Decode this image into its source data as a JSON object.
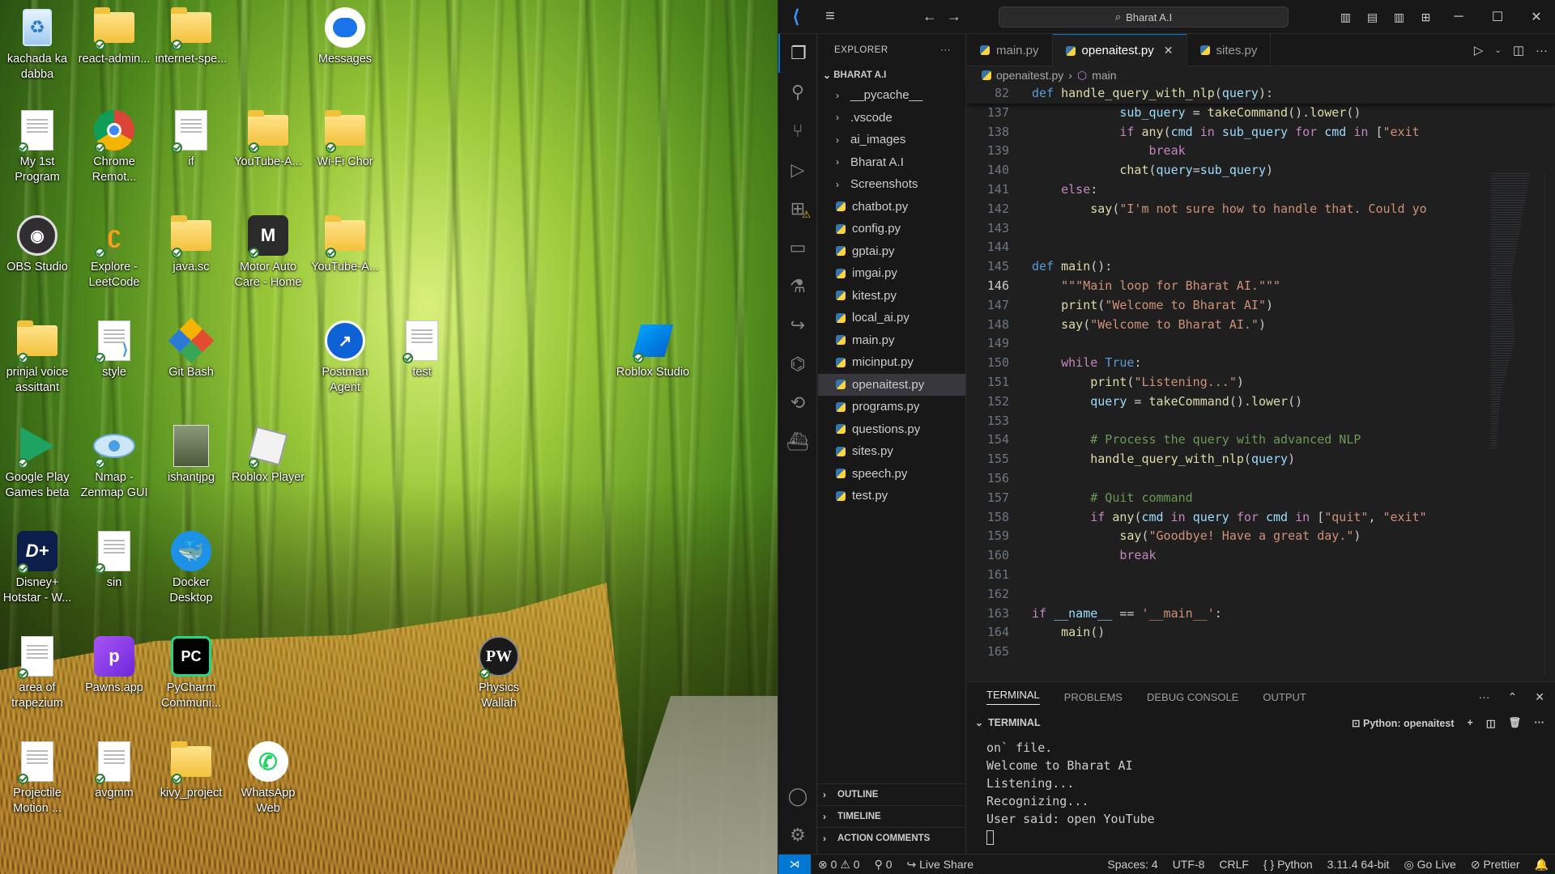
{
  "desktop": {
    "icons": [
      {
        "label": "kachada ka dabba",
        "icon": "recycle-bin-icon"
      },
      {
        "label": "react-admin...",
        "icon": "folder-icon"
      },
      {
        "label": "internet-spe...",
        "icon": "folder-icon"
      },
      {
        "label": "Messages",
        "icon": "messages-icon"
      },
      {
        "label": "My 1st Program",
        "icon": "document-icon"
      },
      {
        "label": "Chrome Remot...",
        "icon": "chrome-remote-icon"
      },
      {
        "label": "if",
        "icon": "document-icon"
      },
      {
        "label": "YouTube-A...",
        "icon": "folder-icon"
      },
      {
        "label": "Wi-Fi Chor",
        "icon": "folder-icon"
      },
      {
        "label": "OBS Studio",
        "icon": "obs-icon"
      },
      {
        "label": "Explore - LeetCode",
        "icon": "leetcode-icon"
      },
      {
        "label": "java.sc",
        "icon": "folder-icon"
      },
      {
        "label": "Motor Auto Care - Home",
        "icon": "motor-auto-icon"
      },
      {
        "label": "YouTube-A...",
        "icon": "folder-icon"
      },
      {
        "label": "prinjal voice assittant",
        "icon": "folder-icon"
      },
      {
        "label": "style",
        "icon": "vscode-file-icon"
      },
      {
        "label": "Git Bash",
        "icon": "git-bash-icon"
      },
      {
        "label": "Postman Agent",
        "icon": "postman-icon"
      },
      {
        "label": "test",
        "icon": "document-icon"
      },
      {
        "label": "Roblox Studio",
        "icon": "roblox-studio-icon"
      },
      {
        "label": "Google Play Games beta",
        "icon": "google-play-games-icon"
      },
      {
        "label": "Nmap - Zenmap GUI",
        "icon": "nmap-icon"
      },
      {
        "label": "ishantjpg",
        "icon": "photo-icon"
      },
      {
        "label": "Roblox Player",
        "icon": "roblox-player-icon"
      },
      {
        "label": "Disney+ Hotstar - W...",
        "icon": "hotstar-icon"
      },
      {
        "label": "sin",
        "icon": "document-icon"
      },
      {
        "label": "Docker Desktop",
        "icon": "docker-icon"
      },
      {
        "label": "area of trapezium",
        "icon": "document-icon"
      },
      {
        "label": "Pawns.app",
        "icon": "pawns-icon"
      },
      {
        "label": "PyCharm Communi...",
        "icon": "pycharm-icon"
      },
      {
        "label": "Physics Wallah",
        "icon": "physics-wallah-icon"
      },
      {
        "label": "Projectile Motion ...",
        "icon": "document-icon"
      },
      {
        "label": "avgmm",
        "icon": "document-icon"
      },
      {
        "label": "kivy_project",
        "icon": "folder-icon"
      },
      {
        "label": "WhatsApp Web",
        "icon": "whatsapp-icon"
      }
    ]
  },
  "vscode": {
    "search": "Bharat A.I",
    "explorer": {
      "title": "EXPLORER",
      "root": "BHARAT A.I",
      "folders": [
        "__pycache__",
        ".vscode",
        "ai_images",
        "Bharat A.I",
        "Screenshots"
      ],
      "files": [
        "chatbot.py",
        "config.py",
        "gptai.py",
        "imgai.py",
        "kitest.py",
        "local_ai.py",
        "main.py",
        "micinput.py",
        "openaitest.py",
        "programs.py",
        "questions.py",
        "sites.py",
        "speech.py",
        "test.py"
      ],
      "selected": "openaitest.py",
      "sections": [
        "OUTLINE",
        "TIMELINE",
        "ACTION COMMENTS"
      ]
    },
    "tabs": [
      {
        "label": "main.py",
        "active": false
      },
      {
        "label": "openaitest.py",
        "active": true
      },
      {
        "label": "sites.py",
        "active": false
      }
    ],
    "breadcrumb": {
      "file": "openaitest.py",
      "symbol": "main"
    },
    "code": {
      "sticky": {
        "ln": "82",
        "text": "def handle_query_with_nlp(query):"
      },
      "lines": [
        {
          "ln": "137",
          "text": "            sub_query = takeCommand().lower()"
        },
        {
          "ln": "138",
          "text": "            if any(cmd in sub_query for cmd in [\"exit"
        },
        {
          "ln": "139",
          "text": "                break"
        },
        {
          "ln": "140",
          "text": "            chat(query=sub_query)"
        },
        {
          "ln": "141",
          "text": "    else:"
        },
        {
          "ln": "142",
          "text": "        say(\"I'm not sure how to handle that. Could yo"
        },
        {
          "ln": "143",
          "text": ""
        },
        {
          "ln": "144",
          "text": ""
        },
        {
          "ln": "145",
          "text": "def main():"
        },
        {
          "ln": "146",
          "text": "    \"\"\"Main loop for Bharat AI.\"\"\""
        },
        {
          "ln": "147",
          "text": "    print(\"Welcome to Bharat AI\")"
        },
        {
          "ln": "148",
          "text": "    say(\"Welcome to Bharat AI.\")"
        },
        {
          "ln": "149",
          "text": ""
        },
        {
          "ln": "150",
          "text": "    while True:"
        },
        {
          "ln": "151",
          "text": "        print(\"Listening...\")"
        },
        {
          "ln": "152",
          "text": "        query = takeCommand().lower()"
        },
        {
          "ln": "153",
          "text": ""
        },
        {
          "ln": "154",
          "text": "        # Process the query with advanced NLP"
        },
        {
          "ln": "155",
          "text": "        handle_query_with_nlp(query)"
        },
        {
          "ln": "156",
          "text": ""
        },
        {
          "ln": "157",
          "text": "        # Quit command"
        },
        {
          "ln": "158",
          "text": "        if any(cmd in query for cmd in [\"quit\", \"exit\""
        },
        {
          "ln": "159",
          "text": "            say(\"Goodbye! Have a great day.\")"
        },
        {
          "ln": "160",
          "text": "            break"
        },
        {
          "ln": "161",
          "text": ""
        },
        {
          "ln": "162",
          "text": ""
        },
        {
          "ln": "163",
          "text": "if __name__ == '__main__':"
        },
        {
          "ln": "164",
          "text": "    main()"
        },
        {
          "ln": "165",
          "text": ""
        }
      ],
      "current_line": "146"
    },
    "panel": {
      "tabs": [
        "TERMINAL",
        "PROBLEMS",
        "DEBUG CONSOLE",
        "OUTPUT"
      ],
      "active_tab": "TERMINAL",
      "terminal_title": "TERMINAL",
      "terminal_instance": "Python: openaitest",
      "output": [
        "on` file.",
        "Welcome to Bharat AI",
        "Listening...",
        "Recognizing...",
        "User said: open YouTube"
      ]
    },
    "statusbar": {
      "errors": "0",
      "warnings": "0",
      "ports": "0",
      "live_share": "Live Share",
      "spaces": "Spaces: 4",
      "encoding": "UTF-8",
      "eol": "CRLF",
      "language": "Python",
      "interpreter": "3.11.4 64-bit",
      "go_live": "Go Live",
      "prettier": "Prettier"
    }
  }
}
